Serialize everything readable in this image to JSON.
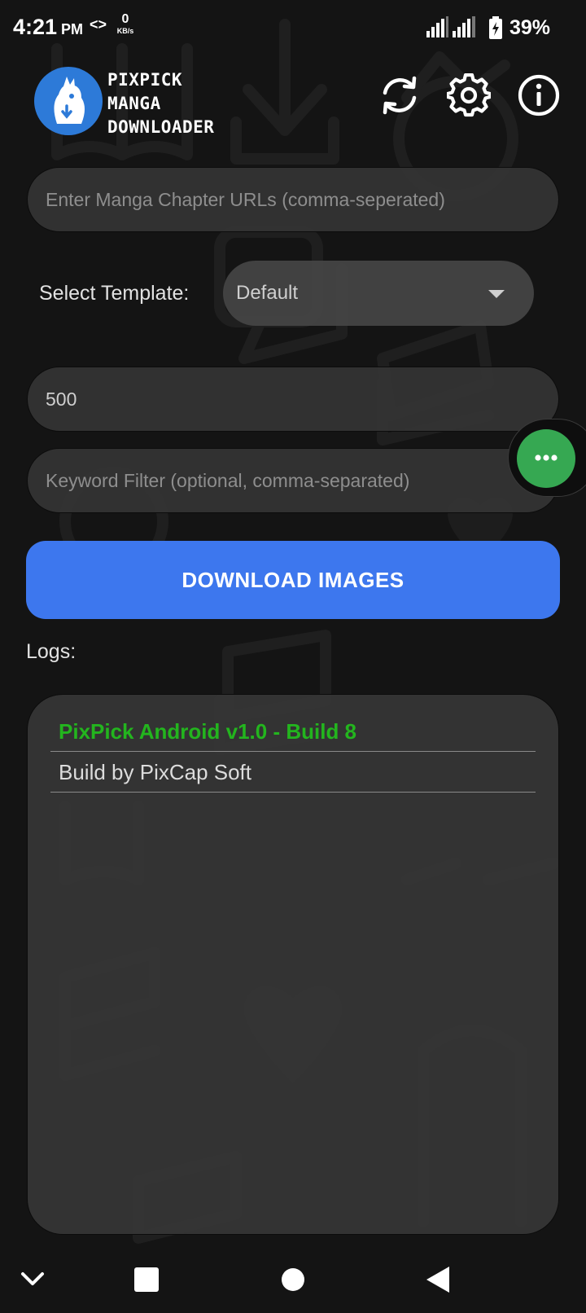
{
  "status_bar": {
    "time": "4:21",
    "ampm": "PM",
    "data_arrows": "<>",
    "speed_value": "0",
    "speed_unit": "KB/s",
    "battery_percent": "39%",
    "icons": [
      "signal-icon",
      "signal-icon",
      "battery-charging-icon"
    ]
  },
  "header": {
    "title_lines": [
      "PIXPICK",
      "MANGA",
      "DOWNLOADER"
    ],
    "icons": [
      "refresh-icon",
      "settings-gear-icon",
      "info-icon"
    ],
    "logo": "chicken-logo-icon"
  },
  "form": {
    "urls_placeholder": "Enter Manga Chapter URLs (comma-seperated)",
    "urls_value": "",
    "template_label": "Select Template:",
    "template_selected": "Default",
    "count_value": "500",
    "keyword_placeholder": "Keyword Filter (optional, comma-separated)",
    "keyword_value": ""
  },
  "download_button": "DOWNLOAD IMAGES",
  "logs": {
    "label": "Logs:",
    "lines": [
      "PixPick Android v1.0 - Build 8",
      "Build by PixCap Soft"
    ]
  },
  "colors": {
    "accent_blue": "#3d77ee",
    "log_green": "#23b51e",
    "fab_green": "#36a852",
    "background": "#141414"
  },
  "nav_bar": {
    "icons": [
      "chevron-down-icon",
      "recents-square-icon",
      "home-circle-icon",
      "back-triangle-icon"
    ]
  }
}
